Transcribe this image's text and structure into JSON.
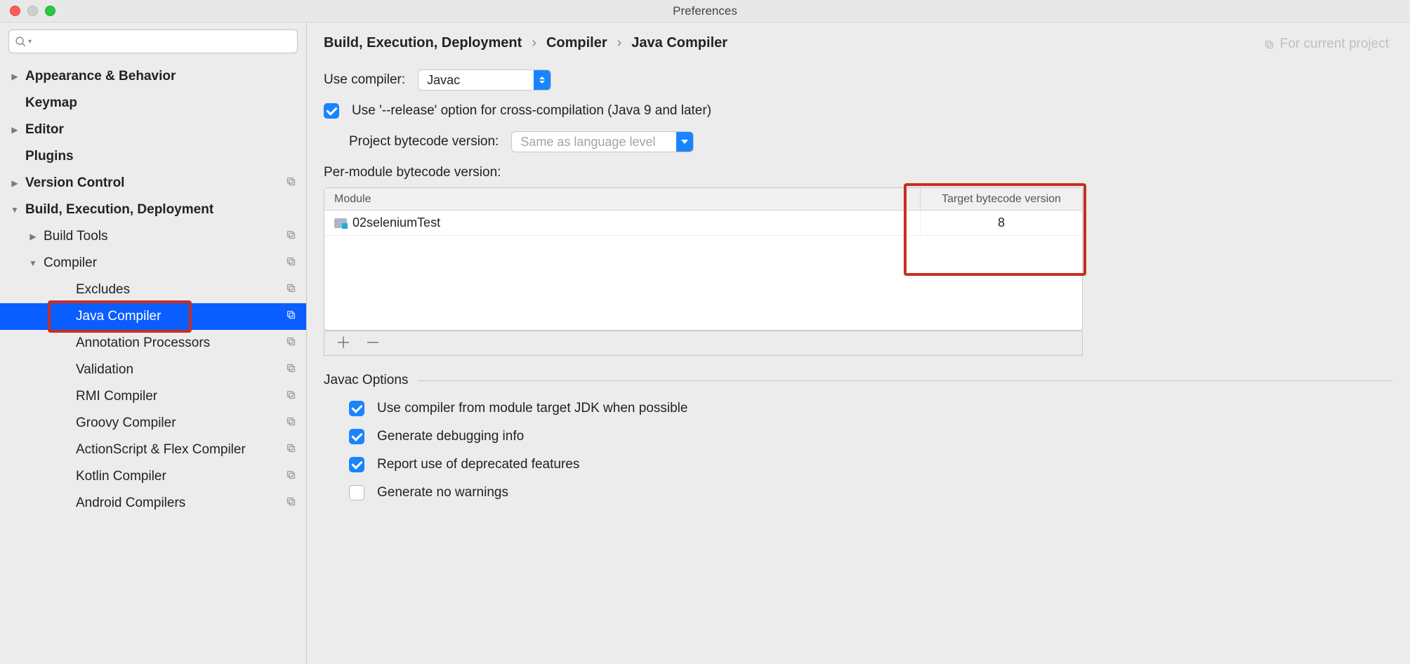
{
  "window": {
    "title": "Preferences"
  },
  "sidebar": {
    "items": [
      {
        "label": "Appearance & Behavior",
        "level": 0,
        "disclosure": "right",
        "copy": false
      },
      {
        "label": "Keymap",
        "level": 0,
        "disclosure": "",
        "copy": false
      },
      {
        "label": "Editor",
        "level": 0,
        "disclosure": "right",
        "copy": false
      },
      {
        "label": "Plugins",
        "level": 0,
        "disclosure": "",
        "copy": false
      },
      {
        "label": "Version Control",
        "level": 0,
        "disclosure": "right",
        "copy": true
      },
      {
        "label": "Build, Execution, Deployment",
        "level": 0,
        "disclosure": "down",
        "copy": false
      },
      {
        "label": "Build Tools",
        "level": 1,
        "disclosure": "right",
        "copy": true
      },
      {
        "label": "Compiler",
        "level": 1,
        "disclosure": "down",
        "copy": true
      },
      {
        "label": "Excludes",
        "level": 2,
        "disclosure": "",
        "copy": true
      },
      {
        "label": "Java Compiler",
        "level": 2,
        "disclosure": "",
        "copy": true,
        "selected": true
      },
      {
        "label": "Annotation Processors",
        "level": 2,
        "disclosure": "",
        "copy": true
      },
      {
        "label": "Validation",
        "level": 2,
        "disclosure": "",
        "copy": true
      },
      {
        "label": "RMI Compiler",
        "level": 2,
        "disclosure": "",
        "copy": true
      },
      {
        "label": "Groovy Compiler",
        "level": 2,
        "disclosure": "",
        "copy": true
      },
      {
        "label": "ActionScript & Flex Compiler",
        "level": 2,
        "disclosure": "",
        "copy": true
      },
      {
        "label": "Kotlin Compiler",
        "level": 2,
        "disclosure": "",
        "copy": true
      },
      {
        "label": "Android Compilers",
        "level": 2,
        "disclosure": "",
        "copy": true
      }
    ]
  },
  "breadcrumb": {
    "a": "Build, Execution, Deployment",
    "b": "Compiler",
    "c": "Java Compiler"
  },
  "scope": {
    "label": "For current project"
  },
  "form": {
    "use_compiler_label": "Use compiler:",
    "use_compiler_value": "Javac",
    "use_release_label": "Use '--release' option for cross-compilation (Java 9 and later)",
    "project_bytecode_label": "Project bytecode version:",
    "project_bytecode_value": "Same as language level",
    "per_module_label": "Per-module bytecode version:"
  },
  "table": {
    "head_module": "Module",
    "head_target": "Target bytecode version",
    "rows": [
      {
        "module": "02seleniumTest",
        "target": "8"
      }
    ]
  },
  "javac": {
    "header": "Javac Options",
    "opt1": "Use compiler from module target JDK when possible",
    "opt2": "Generate debugging info",
    "opt3": "Report use of deprecated features",
    "opt4": "Generate no warnings"
  }
}
